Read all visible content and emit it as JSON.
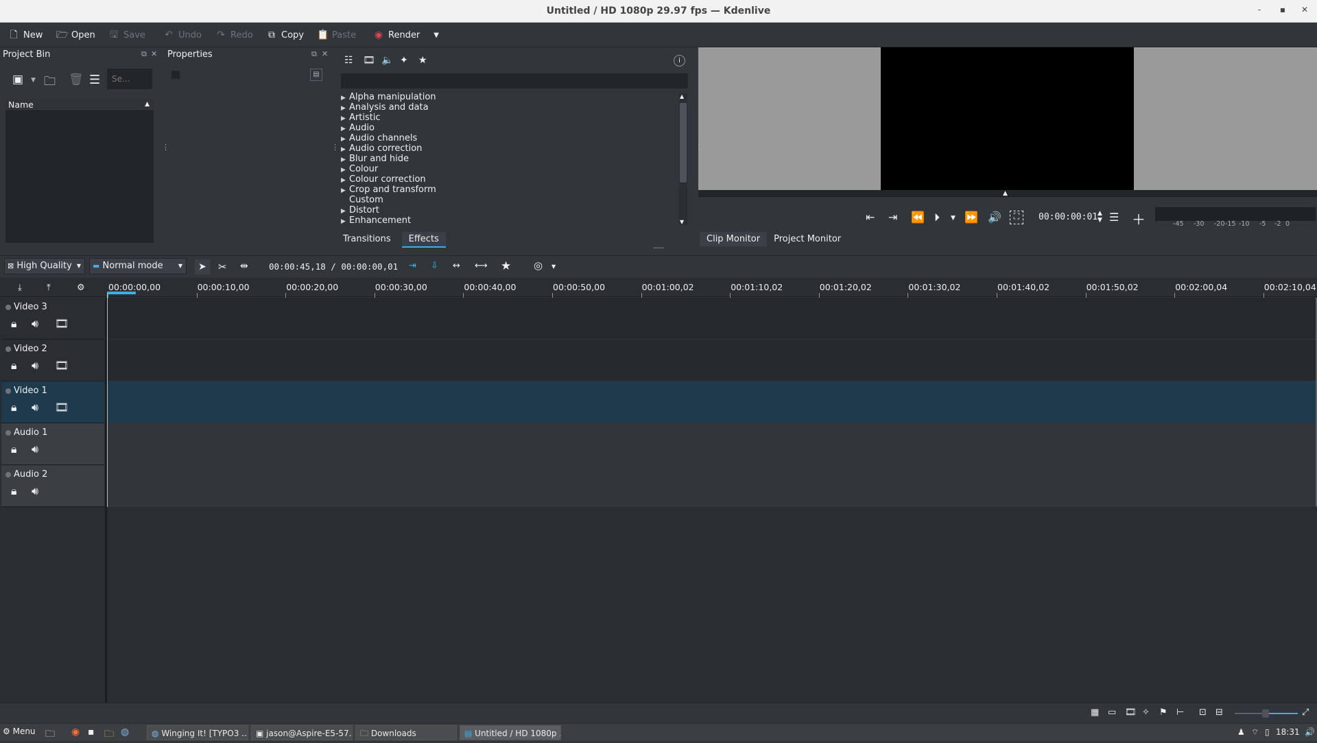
{
  "window": {
    "title": "Untitled / HD 1080p 29.97 fps — Kdenlive"
  },
  "toolbar": {
    "new": "New",
    "open": "Open",
    "save": "Save",
    "undo": "Undo",
    "redo": "Redo",
    "copy": "Copy",
    "paste": "Paste",
    "render": "Render"
  },
  "project_bin": {
    "title": "Project Bin",
    "search_placeholder": "Se...",
    "column_name": "Name"
  },
  "properties": {
    "title": "Properties"
  },
  "effects": {
    "tabs": [
      "Transitions",
      "Effects"
    ],
    "categories": [
      "Alpha manipulation",
      "Analysis and data",
      "Artistic",
      "Audio",
      "Audio channels",
      "Audio correction",
      "Blur and hide",
      "Colour",
      "Colour correction",
      "Crop and transform",
      "Custom",
      "Distort",
      "Enhancement"
    ]
  },
  "monitor": {
    "timecode": "00:00:00:01",
    "tabs": [
      "Clip Monitor",
      "Project Monitor"
    ],
    "meter_labels": [
      "-45",
      "-30",
      "-20",
      "-15",
      "-10",
      "-5",
      "-2",
      "0"
    ]
  },
  "timeline_toolbar": {
    "quality": "High Quality",
    "mode": "Normal mode",
    "position": "00:00:45,18 / 00:00:00,01"
  },
  "ruler": {
    "labels": [
      "00:00:00,00",
      "00:00:10,00",
      "00:00:20,00",
      "00:00:30,00",
      "00:00:40,00",
      "00:00:50,00",
      "00:01:00,02",
      "00:01:10,02",
      "00:01:20,02",
      "00:01:30,02",
      "00:01:40,02",
      "00:01:50,02",
      "00:02:00,04",
      "00:02:10,04"
    ]
  },
  "tracks": [
    {
      "name": "Video 3",
      "type": "video"
    },
    {
      "name": "Video 2",
      "type": "video"
    },
    {
      "name": "Video 1",
      "type": "video",
      "selected": true
    },
    {
      "name": "Audio 1",
      "type": "audio"
    },
    {
      "name": "Audio 2",
      "type": "audio"
    }
  ],
  "taskbar": {
    "menu": "Menu",
    "tasks": [
      "Winging It! [TYPO3 ...",
      "jason@Aspire-E5-57...",
      "Downloads",
      "Untitled / HD 1080p ..."
    ],
    "clock": "18:31"
  },
  "colors": {
    "accent": "#3daee9",
    "track_selected": "#1f3a4d",
    "background": "#31363b"
  }
}
